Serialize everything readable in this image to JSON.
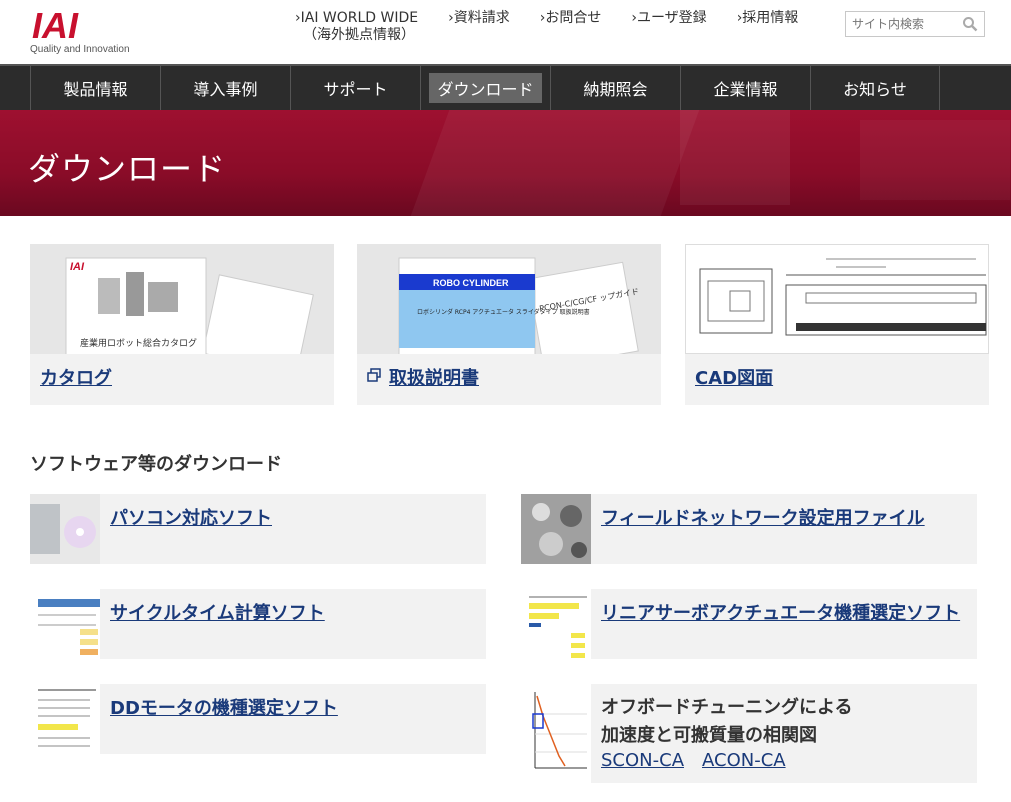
{
  "header": {
    "logo_text": "IAI",
    "logo_tagline": "Quality and Innovation",
    "util_links": [
      {
        "label": "IAI WORLD WIDE",
        "sub": "（海外拠点情報）"
      },
      {
        "label": "資料請求",
        "sub": ""
      },
      {
        "label": "お問合せ",
        "sub": ""
      },
      {
        "label": "ユーザ登録",
        "sub": ""
      },
      {
        "label": "採用情報",
        "sub": ""
      }
    ],
    "search_placeholder": "サイト内検索"
  },
  "nav": {
    "items": [
      "製品情報",
      "導入事例",
      "サポート",
      "ダウンロード",
      "納期照会",
      "企業情報",
      "お知らせ"
    ],
    "active": "ダウンロード"
  },
  "banner": {
    "title": "ダウンロード"
  },
  "cards": [
    {
      "label": "カタログ",
      "thumb_text": "産業用ロボット総合カタログ"
    },
    {
      "label": "取扱説明書",
      "thumb_text_1": "ROBO CYLINDER",
      "thumb_text_2": "ロボシリンダ RCP4 アクチュエータ スライダタイプ 取扱説明書",
      "thumb_text_3": "PCON-C/CG/CF ップガイド"
    },
    {
      "label": "CAD図面"
    }
  ],
  "software": {
    "title": "ソフトウェア等のダウンロード",
    "items": [
      {
        "label": "パソコン対応ソフト"
      },
      {
        "label": "フィールドネットワーク設定用ファイル"
      },
      {
        "label": "サイクルタイム計算ソフト"
      },
      {
        "label": "リニアサーボアクチュエータ機種選定ソフト"
      },
      {
        "label": "DDモータの機種選定ソフト"
      },
      {
        "line1": "オフボードチューニングによる",
        "line2": "加速度と可搬質量の相関図",
        "links": [
          "SCON-CA",
          "ACON-CA"
        ]
      }
    ]
  },
  "colors": {
    "brand": "#c8102e",
    "nav_bg": "#2c2c2c",
    "banner": "#9e1030",
    "link": "#1a3a7a"
  }
}
